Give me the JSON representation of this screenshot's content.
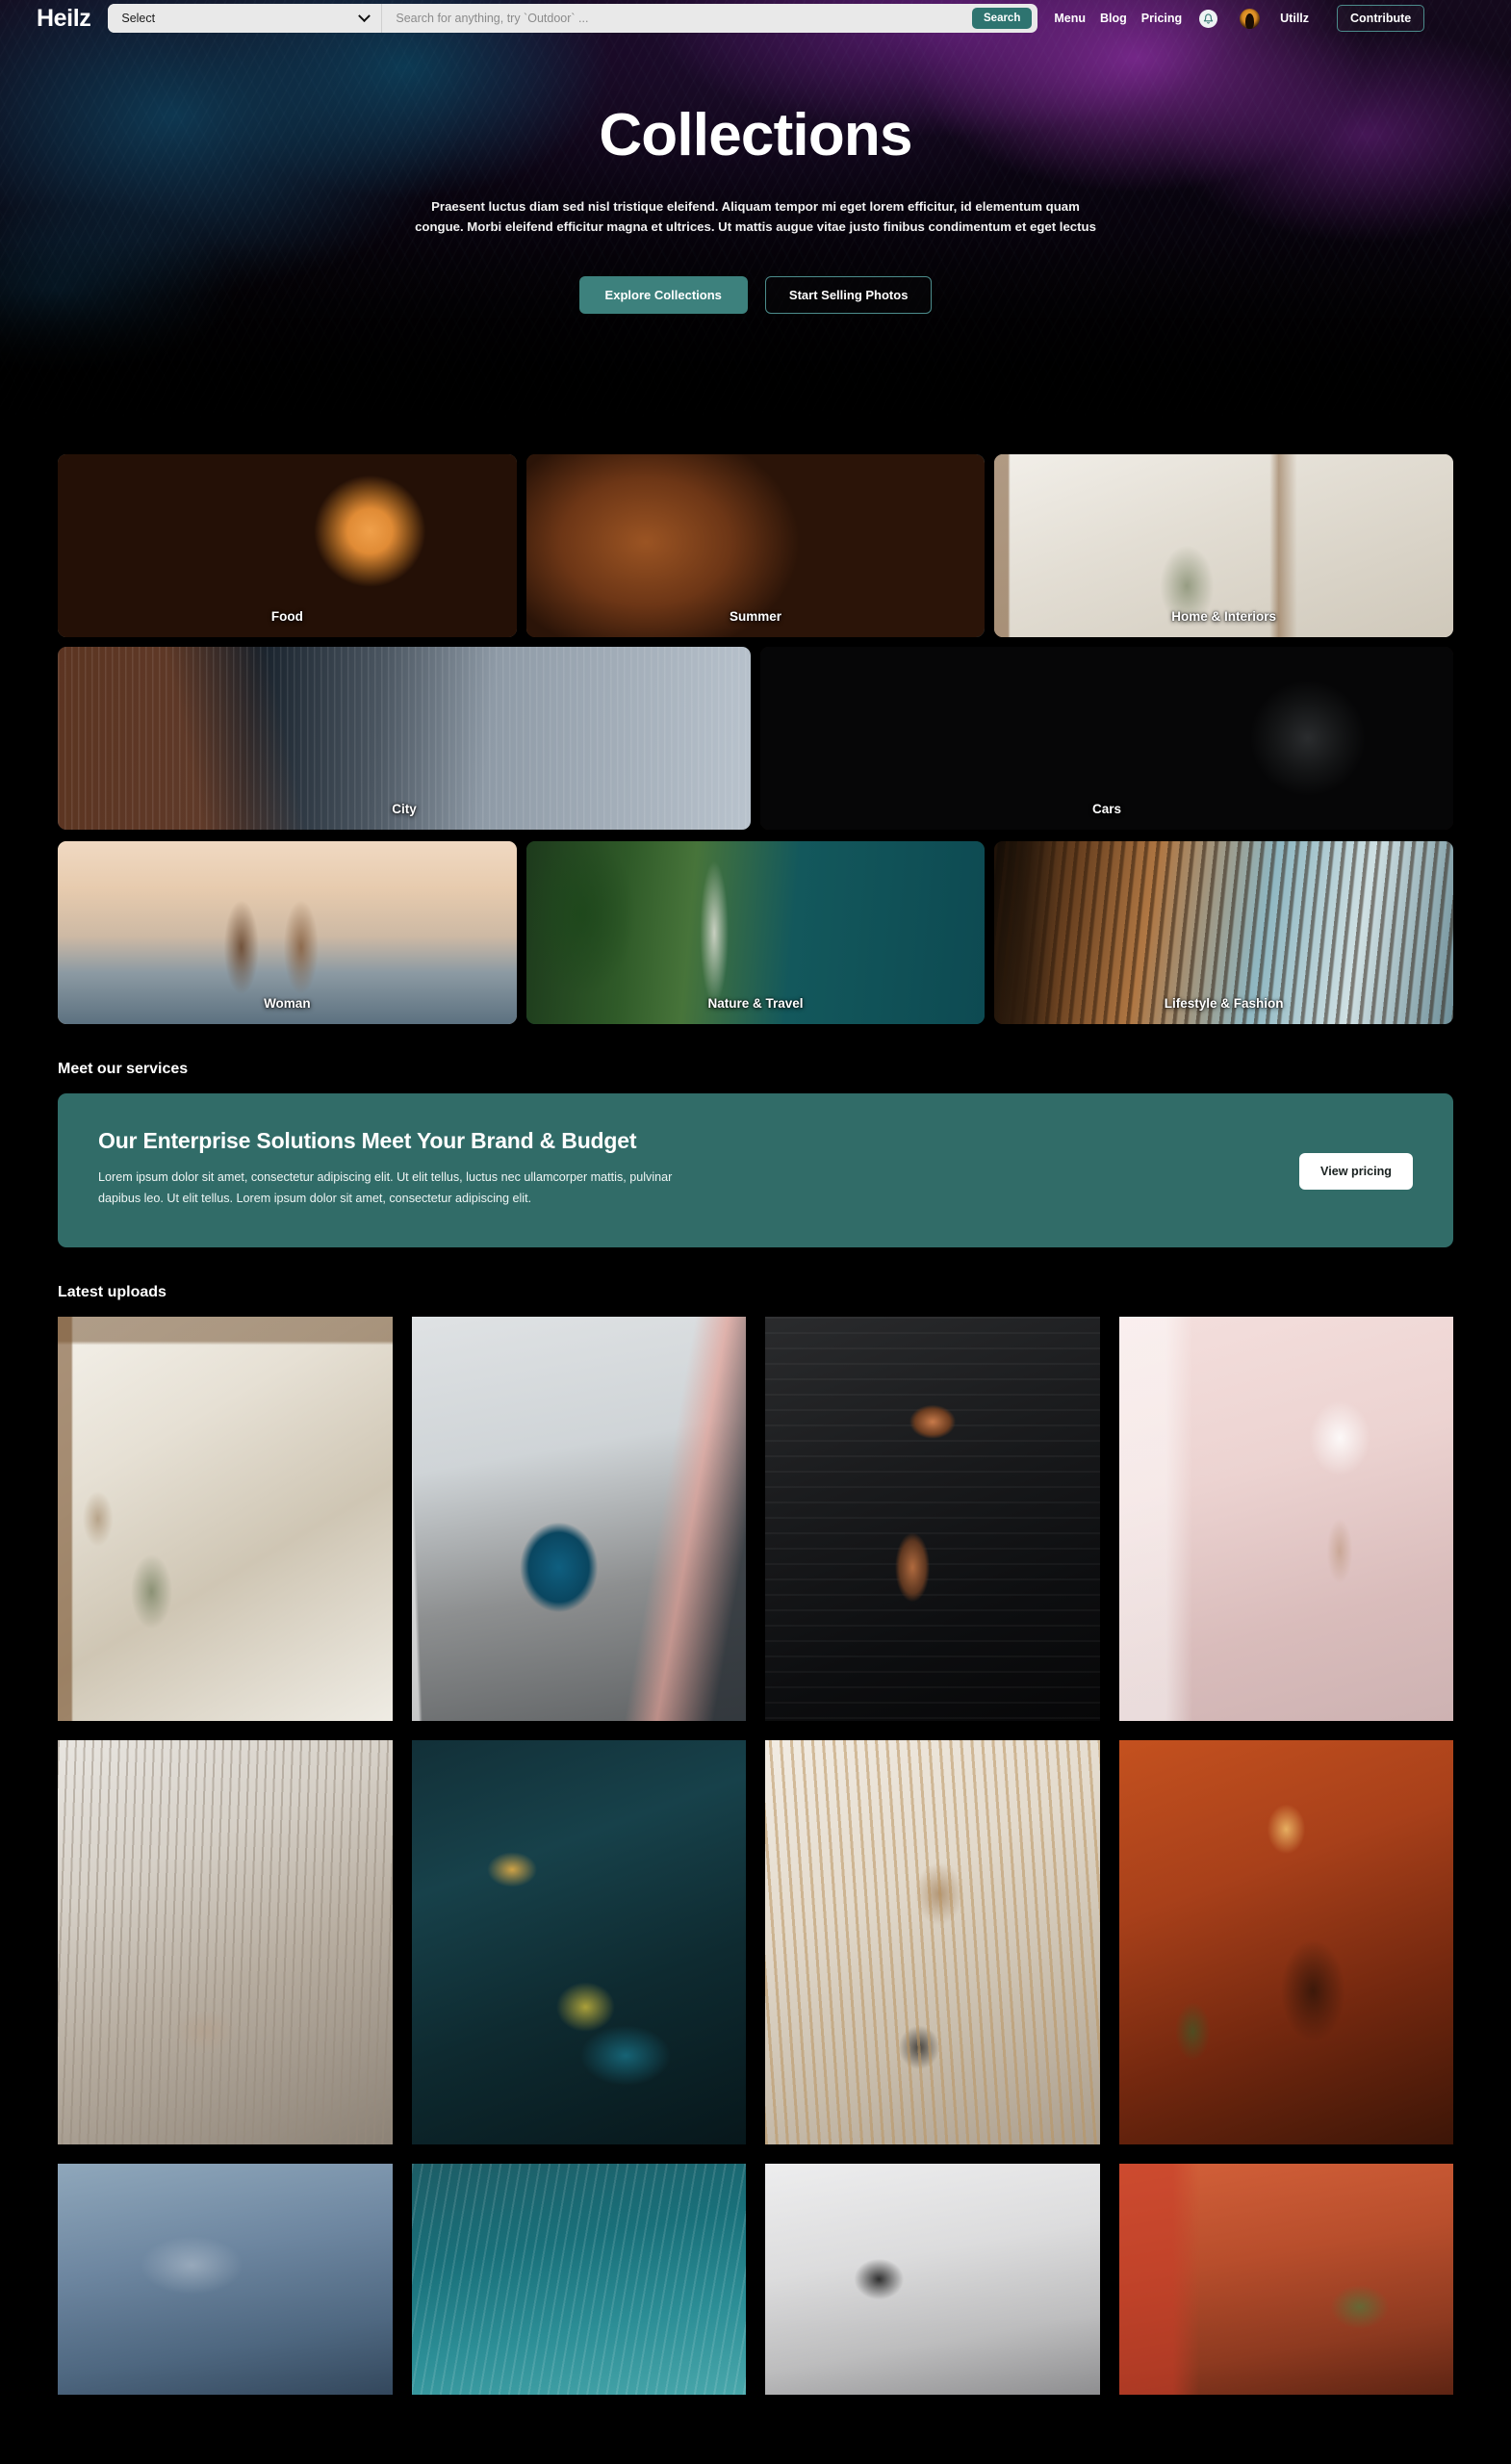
{
  "header": {
    "brand": "Heilz",
    "select_value": "Select",
    "search_placeholder": "Search for anything, try `Outdoor` ...",
    "search_value": "",
    "search_button": "Search",
    "nav": [
      {
        "label": "Menu"
      },
      {
        "label": "Blog"
      },
      {
        "label": "Pricing"
      }
    ],
    "bell_icon": "notification-bell-icon",
    "avatar_icon": "user-avatar",
    "username": "Utillz",
    "contribute_label": "Contribute",
    "dropdown_icon": "chevron-down-icon"
  },
  "hero": {
    "title": "Collections",
    "subtitle": "Praesent luctus diam sed nisl tristique eleifend. Aliquam tempor mi eget lorem efficitur, id elementum quam congue. Morbi eleifend efficitur magna et ultrices. Ut mattis augue vitae justo finibus condimentum et eget lectus",
    "primary_button": "Explore Collections",
    "secondary_button": "Start Selling Photos"
  },
  "collections": {
    "row1": [
      {
        "label": "Food",
        "art": "ph-food"
      },
      {
        "label": "Summer",
        "art": "ph-summer"
      },
      {
        "label": "Home & Interiors",
        "art": "ph-home"
      }
    ],
    "row2": [
      {
        "label": "City",
        "art": "ph-city"
      },
      {
        "label": "Cars",
        "art": "ph-cars"
      }
    ],
    "row3": [
      {
        "label": "Woman",
        "art": "ph-woman"
      },
      {
        "label": "Nature & Travel",
        "art": "ph-nature"
      },
      {
        "label": "Lifestyle & Fashion",
        "art": "ph-life"
      }
    ]
  },
  "services": {
    "heading": "Meet our services",
    "promo_title": "Our Enterprise Solutions Meet Your Brand & Budget",
    "promo_body": "Lorem ipsum dolor sit amet, consectetur adipiscing elit. Ut elit tellus, luctus nec ullamcorper mattis, pulvinar dapibus leo. Ut elit tellus. Lorem ipsum dolor sit amet, consectetur adipiscing elit.",
    "promo_button": "View pricing"
  },
  "uploads": {
    "heading": "Latest uploads"
  },
  "colors": {
    "accent_teal": "#2e7470",
    "promo_teal": "#316c68",
    "page_background": "#000000",
    "text_primary": "#ffffff",
    "search_background": "#e9e9e9",
    "border_teal": "#4c8c8c"
  }
}
